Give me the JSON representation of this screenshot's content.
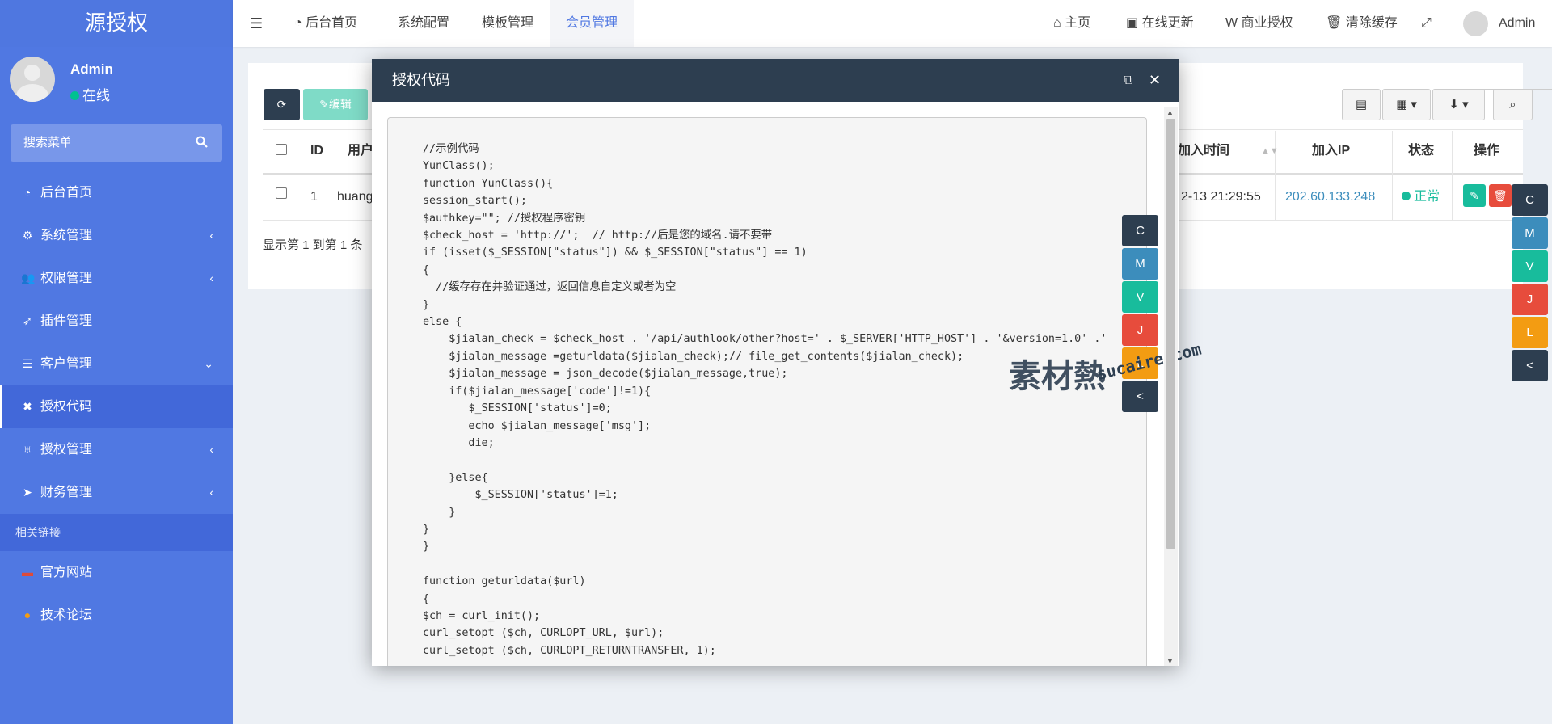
{
  "sidebar": {
    "logo": "源授权",
    "user_name": "Admin",
    "user_status": "在线",
    "search_label": "搜索菜单",
    "items": [
      {
        "label": "后台首页",
        "icon": "dashboard-icon",
        "arrow": ""
      },
      {
        "label": "系统管理",
        "icon": "cogs-icon",
        "arrow": "‹"
      },
      {
        "label": "权限管理",
        "icon": "users-icon",
        "arrow": "‹"
      },
      {
        "label": "插件管理",
        "icon": "rocket-icon",
        "arrow": ""
      },
      {
        "label": "客户管理",
        "icon": "list-icon",
        "arrow": "⌄"
      },
      {
        "label": "授权代码",
        "icon": "code-icon",
        "arrow": ""
      },
      {
        "label": "授权管理",
        "icon": "gitlab-icon",
        "arrow": "‹"
      },
      {
        "label": "财务管理",
        "icon": "paper-plane-icon",
        "arrow": "‹"
      }
    ],
    "links_header": "相关链接",
    "links": [
      {
        "label": "官方网站",
        "icon": "square-icon",
        "color": "#dd4b39"
      },
      {
        "label": "技术论坛",
        "icon": "comment-icon",
        "color": "#f39c12"
      }
    ]
  },
  "topbar": {
    "menu_icon": "bars-icon",
    "tabs": [
      "后台首页",
      "系统配置",
      "模板管理",
      "会员管理"
    ],
    "right": [
      "主页",
      "在线更新",
      "商业授权",
      "清除缓存"
    ],
    "user": "Admin"
  },
  "toolbar": {
    "edit_label": "编辑",
    "search_placeholder": "索"
  },
  "table": {
    "headers": [
      "ID",
      "用户",
      "加入时间",
      "加入IP",
      "状态",
      "操作"
    ],
    "row": {
      "id": "1",
      "user": "huang",
      "time": "2-13 21:29:55",
      "ip": "202.60.133.248",
      "status": "正常"
    },
    "footer": "显示第 1 到第 1 条"
  },
  "modal": {
    "title": "授权代码",
    "code": "//示例代码\nYunClass();\nfunction YunClass(){\nsession_start();\n$authkey=\"\"; //授权程序密钥\n$check_host = 'http://';  // http://后是您的域名.请不要带\nif (isset($_SESSION[\"status\"]) && $_SESSION[\"status\"] == 1)\n{\n  //缓存存在并验证通过，返回信息自定义或者为空\n}\nelse {\n    $jialan_check = $check_host . '/api/authlook/other?host=' . $_SERVER['HTTP_HOST'] . '&version=1.0' .'\n    $jialan_message =geturldata($jialan_check);// file_get_contents($jialan_check);\n    $jialan_message = json_decode($jialan_message,true);\n    if($jialan_message['code']!=1){\n       $_SESSION['status']=0;\n       echo $jialan_message['msg'];\n       die;\n\n    }else{\n        $_SESSION['status']=1;\n    }\n}\n}\n\nfunction geturldata($url)\n{\n$ch = curl_init();\ncurl_setopt ($ch, CURLOPT_URL, $url);\ncurl_setopt ($ch, CURLOPT_RETURNTRANSFER, 1);"
  },
  "side_buttons": [
    {
      "label": "C",
      "color": "#2d3e50"
    },
    {
      "label": "M",
      "color": "#3c8dbc"
    },
    {
      "label": "V",
      "color": "#18bc9c"
    },
    {
      "label": "J",
      "color": "#e74c3c"
    },
    {
      "label": "L",
      "color": "#f39c12"
    },
    {
      "label": "<",
      "color": "#2d3e50"
    }
  ],
  "watermark": {
    "text1": "素材熱",
    "text2": "sucaire.com"
  },
  "colors": {
    "sidebar": "#5078e2",
    "modal_header": "#2d3e50",
    "success": "#18bc9c",
    "danger": "#e74c3c",
    "link": "#3c8dbc"
  }
}
